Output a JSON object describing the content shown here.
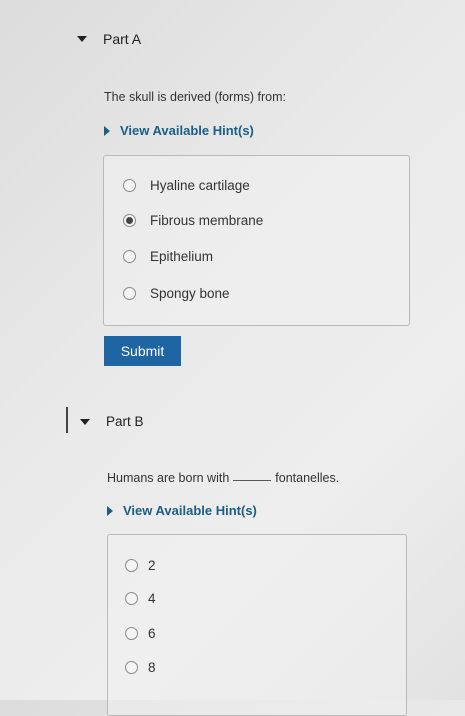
{
  "part_a": {
    "title": "Part A",
    "question": "The skull is derived (forms) from:",
    "hint_label": "View Available Hint(s)",
    "choices": [
      {
        "label": "Hyaline cartilage",
        "selected": false
      },
      {
        "label": "Fibrous membrane",
        "selected": true
      },
      {
        "label": "Epithelium",
        "selected": false
      },
      {
        "label": "Spongy bone",
        "selected": false
      }
    ],
    "submit_label": "Submit"
  },
  "part_b": {
    "title": "Part B",
    "question_before": "Humans are born with",
    "question_after": "fontanelles.",
    "hint_label": "View Available Hint(s)",
    "choices": [
      {
        "label": "2",
        "selected": false
      },
      {
        "label": "4",
        "selected": false
      },
      {
        "label": "6",
        "selected": false
      },
      {
        "label": "8",
        "selected": false
      }
    ]
  }
}
